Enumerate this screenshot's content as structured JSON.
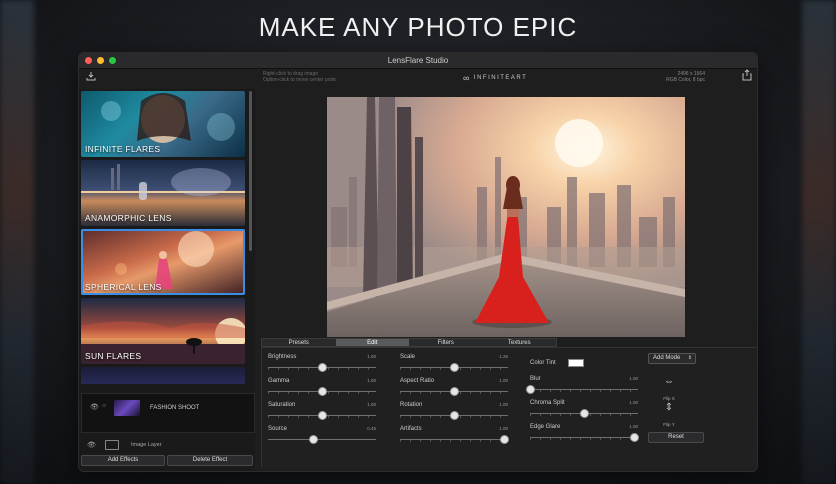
{
  "headline": "MAKE ANY PHOTO EPIC",
  "window": {
    "title": "LensFlare Studio",
    "hint_line1": "Right-click to drag image",
    "hint_line2": "Option-click to move center point",
    "brand": "INFINITEART",
    "brand_icon": "infinity-icon",
    "dims_line1": "2496 x 1664",
    "dims_line2": "RGB Color, 8 bpc",
    "download_icon": "download-icon",
    "share_icon": "share-icon"
  },
  "sidebar": {
    "cards": [
      {
        "label": "INFINITE FLARES",
        "selected": false
      },
      {
        "label": "ANAMORPHIC LENS",
        "selected": false
      },
      {
        "label": "SPHERICAL LENS",
        "selected": true
      },
      {
        "label": "SUN FLARES",
        "selected": false
      },
      {
        "label": "",
        "selected": false
      }
    ],
    "layer_name": "FASHION SHOOT",
    "image_layer_label": "Image Layer",
    "add_effects": "Add Effects",
    "delete_effect": "Delete Effect"
  },
  "tabs": [
    {
      "label": "Presets",
      "active": false
    },
    {
      "label": "Edit",
      "active": true
    },
    {
      "label": "Filters",
      "active": false
    },
    {
      "label": "Textures",
      "active": false
    }
  ],
  "controls": {
    "col1": [
      {
        "label": "Brightness",
        "value": "1.00",
        "pos": 0.5
      },
      {
        "label": "Gamma",
        "value": "1.00",
        "pos": 0.5
      },
      {
        "label": "Saturation",
        "value": "1.00",
        "pos": 0.5
      },
      {
        "label": "Source",
        "value": "0.45",
        "pos": 0.42
      }
    ],
    "col2": [
      {
        "label": "Scale",
        "value": "1.26",
        "pos": 0.5
      },
      {
        "label": "Aspect Ratio",
        "value": "1.00",
        "pos": 0.5
      },
      {
        "label": "Rotation",
        "value": "1.00",
        "pos": 0.5
      },
      {
        "label": "Artifacts",
        "value": "1.00",
        "pos": 0.97
      }
    ],
    "col3": [
      {
        "label": "Blur",
        "value": "1.00",
        "pos": 0.0
      },
      {
        "label": "Chroma Split",
        "value": "1.00",
        "pos": 0.5
      },
      {
        "label": "Edge Glare",
        "value": "1.00",
        "pos": 0.97
      }
    ],
    "color_tint_label": "Color Tint",
    "color_tint": "#ffffff",
    "add_mode": "Add Mode",
    "flip_x": "Flip X",
    "flip_y": "Flip Y",
    "reset": "Reset"
  }
}
